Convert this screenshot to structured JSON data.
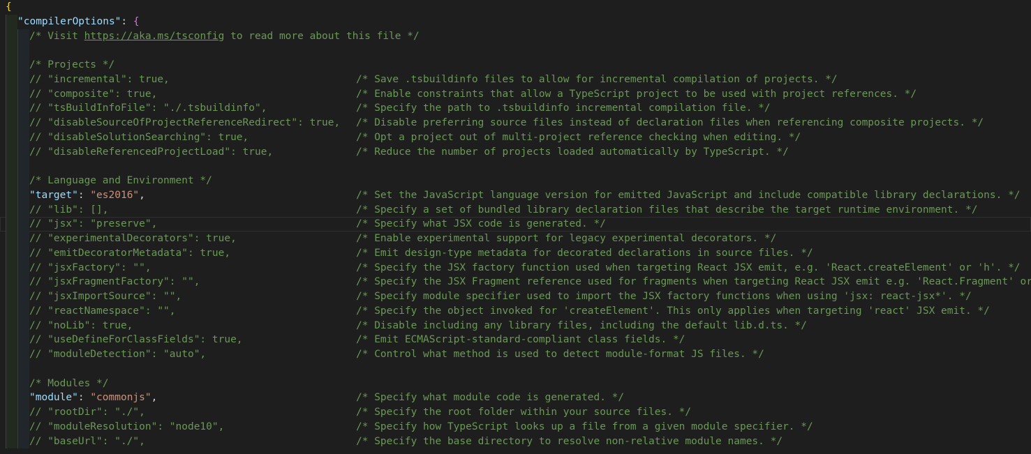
{
  "editor": {
    "open_brace": "{",
    "compiler_options_key": "\"compilerOptions\"",
    "compiler_options_colon": ": ",
    "compiler_options_brace": "{",
    "visit_prefix": "/* Visit ",
    "visit_link": "https://aka.ms/tsconfig",
    "visit_suffix": " to read more about this file */",
    "sections": {
      "projects": "/* Projects */",
      "language": "/* Language and Environment */",
      "modules": "/* Modules */"
    },
    "target_line": {
      "key": "\"target\"",
      "value": "\"es2016\"",
      "desc": "/* Set the JavaScript language version for emitted JavaScript and include compatible library declarations. */"
    },
    "module_line": {
      "key": "\"module\"",
      "value": "\"commonjs\"",
      "desc": "/* Specify what module code is generated. */"
    },
    "projects_lines": [
      {
        "code": "// \"incremental\": true,",
        "desc": "/* Save .tsbuildinfo files to allow for incremental compilation of projects. */"
      },
      {
        "code": "// \"composite\": true,",
        "desc": "/* Enable constraints that allow a TypeScript project to be used with project references. */"
      },
      {
        "code": "// \"tsBuildInfoFile\": \"./.tsbuildinfo\",",
        "desc": "/* Specify the path to .tsbuildinfo incremental compilation file. */"
      },
      {
        "code": "// \"disableSourceOfProjectReferenceRedirect\": true,",
        "desc": "/* Disable preferring source files instead of declaration files when referencing composite projects. */"
      },
      {
        "code": "// \"disableSolutionSearching\": true,",
        "desc": "/* Opt a project out of multi-project reference checking when editing. */"
      },
      {
        "code": "// \"disableReferencedProjectLoad\": true,",
        "desc": "/* Reduce the number of projects loaded automatically by TypeScript. */"
      }
    ],
    "language_lines": [
      {
        "code": "// \"lib\": [],",
        "desc": "/* Specify a set of bundled library declaration files that describe the target runtime environment. */"
      },
      {
        "code": "// \"jsx\": \"preserve\",",
        "desc": "/* Specify what JSX code is generated. */"
      },
      {
        "code": "// \"experimentalDecorators\": true,",
        "desc": "/* Enable experimental support for legacy experimental decorators. */"
      },
      {
        "code": "// \"emitDecoratorMetadata\": true,",
        "desc": "/* Emit design-type metadata for decorated declarations in source files. */"
      },
      {
        "code": "// \"jsxFactory\": \"\",",
        "desc": "/* Specify the JSX factory function used when targeting React JSX emit, e.g. 'React.createElement' or 'h'. */"
      },
      {
        "code": "// \"jsxFragmentFactory\": \"\",",
        "desc": "/* Specify the JSX Fragment reference used for fragments when targeting React JSX emit e.g. 'React.Fragment' or 'Fragment'. */"
      },
      {
        "code": "// \"jsxImportSource\": \"\",",
        "desc": "/* Specify module specifier used to import the JSX factory functions when using 'jsx: react-jsx*'. */"
      },
      {
        "code": "// \"reactNamespace\": \"\",",
        "desc": "/* Specify the object invoked for 'createElement'. This only applies when targeting 'react' JSX emit. */"
      },
      {
        "code": "// \"noLib\": true,",
        "desc": "/* Disable including any library files, including the default lib.d.ts. */"
      },
      {
        "code": "// \"useDefineForClassFields\": true,",
        "desc": "/* Emit ECMAScript-standard-compliant class fields. */"
      },
      {
        "code": "// \"moduleDetection\": \"auto\",",
        "desc": "/* Control what method is used to detect module-format JS files. */"
      }
    ],
    "module_lines": [
      {
        "code": "// \"rootDir\": \"./\",",
        "desc": "/* Specify the root folder within your source files. */"
      },
      {
        "code": "// \"moduleResolution\": \"node10\",",
        "desc": "/* Specify how TypeScript looks up a file from a given module specifier. */"
      },
      {
        "code": "// \"baseUrl\": \"./\",",
        "desc": "/* Specify the base directory to resolve non-relative module names. */"
      }
    ],
    "colors": {
      "background": "#1e1e1e",
      "comment": "#6a9955",
      "key": "#9cdcfe",
      "string": "#ce9178",
      "brace_level1": "#ffd700",
      "brace_level2": "#da70d6"
    }
  }
}
